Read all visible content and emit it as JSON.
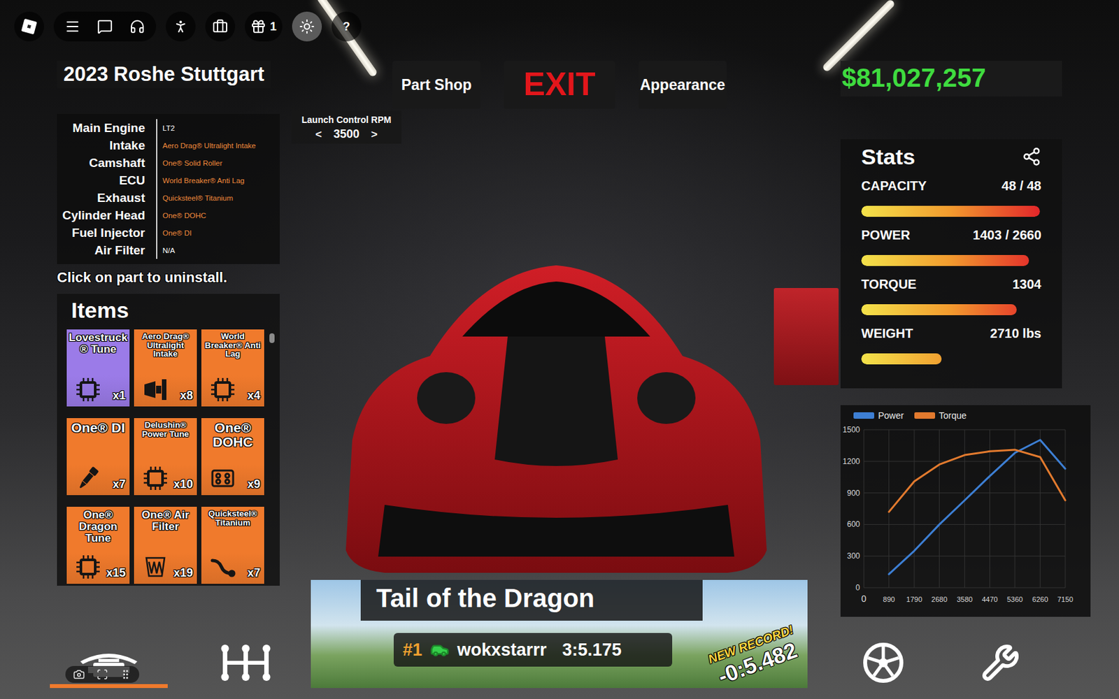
{
  "topbar": [
    [
      {
        "kind": "logo",
        "selected": false
      }
    ],
    [
      {
        "kind": "menu",
        "selected": false
      },
      {
        "kind": "chat",
        "selected": false
      },
      {
        "kind": "voice",
        "selected": false
      }
    ],
    [
      {
        "kind": "emote",
        "selected": false
      }
    ],
    [
      {
        "kind": "backpack",
        "selected": false
      }
    ],
    [
      {
        "kind": "gift",
        "selected": false,
        "badge": "1"
      }
    ],
    [
      {
        "kind": "brightness",
        "selected": true
      }
    ],
    [
      {
        "kind": "help",
        "selected": false,
        "label": "?"
      }
    ]
  ],
  "car": {
    "title": "2023 Roshe Stuttgart"
  },
  "nav": [
    {
      "label": "Part Shop",
      "kind": "plain"
    },
    {
      "label": "EXIT",
      "kind": "exit"
    },
    {
      "label": "Appearance",
      "kind": "plain"
    }
  ],
  "money": "$81,027,257",
  "launch_control": {
    "title": "Launch Control RPM",
    "prev": "<",
    "value": "3500",
    "next": ">"
  },
  "parts": {
    "rows": [
      {
        "label": "Main Engine",
        "value": "LT2",
        "color": "#ffffff"
      },
      {
        "label": "Intake",
        "value": "Aero Drag® Ultralight Intake",
        "color": "#f08a3c"
      },
      {
        "label": "Camshaft",
        "value": "One® Solid Roller",
        "color": "#f08a3c"
      },
      {
        "label": "ECU",
        "value": "World Breaker® Anti Lag",
        "color": "#f08a3c"
      },
      {
        "label": "Exhaust",
        "value": "Quicksteel® Titanium",
        "color": "#f08a3c"
      },
      {
        "label": "Cylinder Head",
        "value": "One® DOHC",
        "color": "#f08a3c"
      },
      {
        "label": "Fuel Injector",
        "value": "One® DI",
        "color": "#f08a3c"
      },
      {
        "label": "Air Filter",
        "value": "N/A",
        "color": "#ffffff"
      }
    ],
    "hint": "Click on part to uninstall."
  },
  "items": {
    "title": "Items",
    "scroll": {
      "level": 0.04
    },
    "tiles": [
      {
        "name": "Lovestruck® Tune",
        "count": "x1",
        "kind": "chip",
        "color": "#9b7be8"
      },
      {
        "name": "Aero Drag® Ultralight Intake",
        "count": "x8",
        "kind": "intake",
        "color": "#f07a2c"
      },
      {
        "name": "World Breaker® Anti Lag",
        "count": "x4",
        "kind": "chip",
        "color": "#f07a2c"
      },
      {
        "name": "One® DI",
        "count": "x7",
        "kind": "injector",
        "color": "#f07a2c"
      },
      {
        "name": "Delushin® Power Tune",
        "count": "x10",
        "kind": "chip",
        "color": "#f07a2c"
      },
      {
        "name": "One® DOHC",
        "count": "x9",
        "kind": "head",
        "color": "#f07a2c"
      },
      {
        "name": "One® Dragon Tune",
        "count": "x15",
        "kind": "chip",
        "color": "#f07a2c"
      },
      {
        "name": "One® Air Filter",
        "count": "x19",
        "kind": "filter",
        "color": "#f07a2c"
      },
      {
        "name": "Quicksteel® Titanium",
        "count": "x7",
        "kind": "exhaust",
        "color": "#f07a2c"
      }
    ]
  },
  "stats": {
    "title": "Stats",
    "rows": [
      {
        "label": "CAPACITY",
        "value": "48 / 48",
        "level": 1.0
      },
      {
        "label": "POWER",
        "value": "1403 / 2660",
        "level": 0.94
      },
      {
        "label": "TORQUE",
        "value": "1304",
        "level": 0.87
      },
      {
        "label": "WEIGHT",
        "value": "2710 lbs",
        "level": 0.45
      }
    ]
  },
  "chart": {
    "y_ticks": [
      "1500",
      "1200",
      "900",
      "600",
      "300",
      "0"
    ],
    "x_ticks": [
      "0",
      "890",
      "1790",
      "2680",
      "3580",
      "4470",
      "5360",
      "6260",
      "7150"
    ],
    "x_values": [
      890,
      1790,
      2680,
      3580,
      4470,
      5360,
      6260,
      7150
    ],
    "series": [
      {
        "name": "Power",
        "color": "#3d7fd4",
        "values": [
          128,
          350,
          600,
          830,
          1060,
          1280,
          1403,
          1130
        ]
      },
      {
        "name": "Torque",
        "color": "#e27a2e",
        "values": [
          720,
          1010,
          1170,
          1260,
          1295,
          1310,
          1240,
          830
        ]
      }
    ]
  },
  "left_tabs": [
    {
      "kind": "engine",
      "selected": true
    },
    {
      "kind": "shifter",
      "selected": false
    }
  ],
  "right_tabs": [
    {
      "kind": "wheel",
      "selected": false
    },
    {
      "kind": "tools",
      "selected": false
    }
  ],
  "capture_tools": [
    {
      "kind": "screenshot"
    },
    {
      "kind": "record"
    },
    {
      "kind": "grip"
    }
  ],
  "leaderboard": {
    "track": "Tail of the Dragon",
    "rank": "#1",
    "player": "wokxstarrr",
    "time": "3:5.175",
    "badge": "NEW RECORD!",
    "delta": "-0:5.482"
  }
}
